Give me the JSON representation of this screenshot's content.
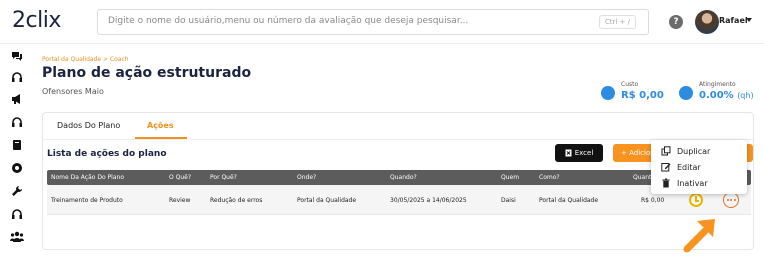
{
  "header": {
    "logo_num": "2",
    "logo_text": "clix",
    "search_placeholder": "Digite o nome do usuário,menu ou número da avaliação que deseja pesquisar...",
    "search_shortcut": "Ctrl + /",
    "help_label": "?",
    "user_name": "Rafael"
  },
  "sidebar": {
    "icons": [
      "chat-icon",
      "headset-icon",
      "megaphone-icon",
      "headphones-icon",
      "book-icon",
      "target-icon",
      "wrench-icon",
      "headphones-icon",
      "users-icon"
    ]
  },
  "page": {
    "breadcrumb": "Portal da Qualidade  >  Coach",
    "title": "Plano de ação estruturado",
    "subtitle": "Ofensores Maio",
    "kpi_cost_label": "Custo",
    "kpi_cost_value": "R$ 0,00",
    "kpi_achievement_label": "Atingimento",
    "kpi_achievement_value": "0.00%",
    "kpi_achievement_unit": "(qh)"
  },
  "tabs": [
    {
      "label": "Dados Do Plano",
      "active": false
    },
    {
      "label": "Ações",
      "active": true
    }
  ],
  "list": {
    "title": "Lista de ações do plano",
    "excel_label": "Excel",
    "add_label": "+ Adicionar",
    "columns": [
      "Nome Da Ação Do Plano",
      "O Quê?",
      "Por Quê?",
      "Onde?",
      "Quando?",
      "Quem",
      "Como?",
      "Quanto?"
    ],
    "rows": [
      {
        "name": "Treinamento de Produto",
        "what": "Review",
        "why": "Redução de erros",
        "where": "Portal da Qualidade",
        "when": "30/05/2025 a 14/06/2025",
        "who": "Daisi",
        "how": "Portal da Qualidade",
        "how_much": "R$ 0,00"
      }
    ]
  },
  "menu": {
    "items": [
      {
        "label": "Duplicar",
        "icon": "copy-icon"
      },
      {
        "label": "Editar",
        "icon": "edit-icon"
      },
      {
        "label": "Inativar",
        "icon": "trash-icon"
      }
    ]
  },
  "colors": {
    "accent": "#f7931e",
    "primary": "#1c2340",
    "kpi": "#2d8ce0"
  }
}
